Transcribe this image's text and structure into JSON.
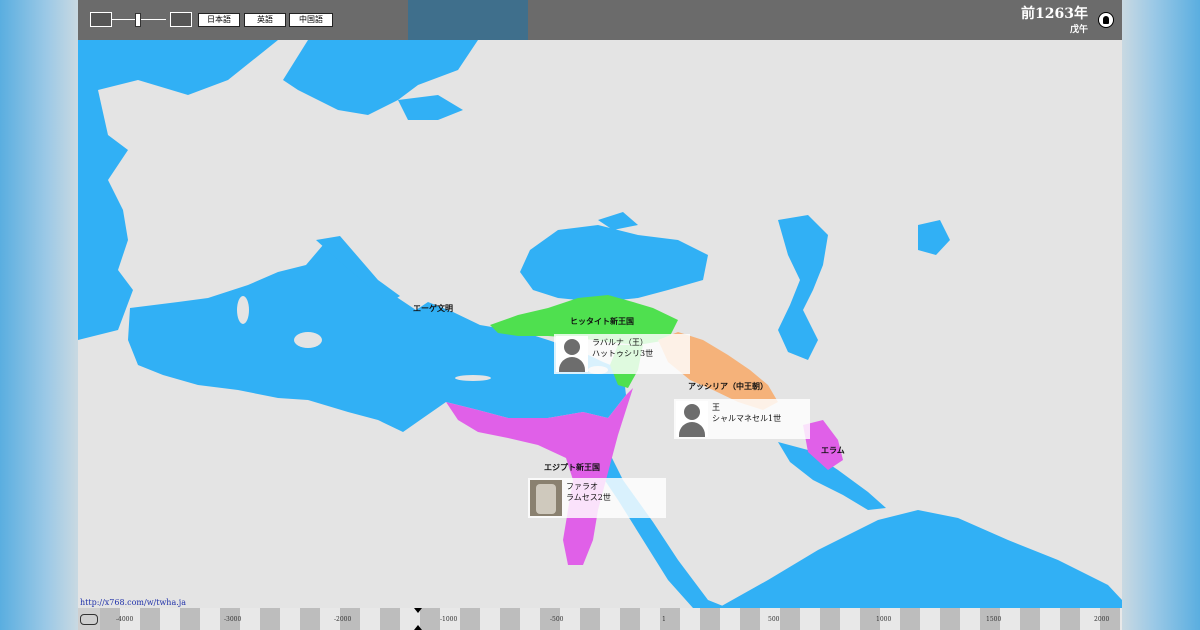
{
  "header": {
    "languages": [
      "日本語",
      "英語",
      "中国語"
    ],
    "year": "前1263年",
    "eto": "戊午"
  },
  "map": {
    "labels": {
      "aegean": "エーゲ文明",
      "hittite": "ヒッタイト新王国",
      "assyria": "アッシリア（中王朝）",
      "egypt": "エジプト新王国",
      "elam": "エラム"
    },
    "colors": {
      "sea": "#31b0f5",
      "land": "#e4e4e4",
      "hittite": "#4fe04f",
      "assyria": "#f5b27a",
      "egypt": "#e060e8",
      "elam": "#e060e8"
    }
  },
  "rulers": [
    {
      "title": "ラバルナ（王）",
      "name": "ハットゥシリ3世"
    },
    {
      "title": "王",
      "name": "シャルマネセル1世"
    },
    {
      "title": "ファラオ",
      "name": "ラムセス2世"
    }
  ],
  "footer": {
    "url": "http://x768.com/w/twha.ja",
    "timeline_ticks": [
      "-4000",
      "-3000",
      "-2000",
      "-1000",
      "-500",
      "1",
      "500",
      "1000",
      "1500",
      "2000"
    ]
  }
}
